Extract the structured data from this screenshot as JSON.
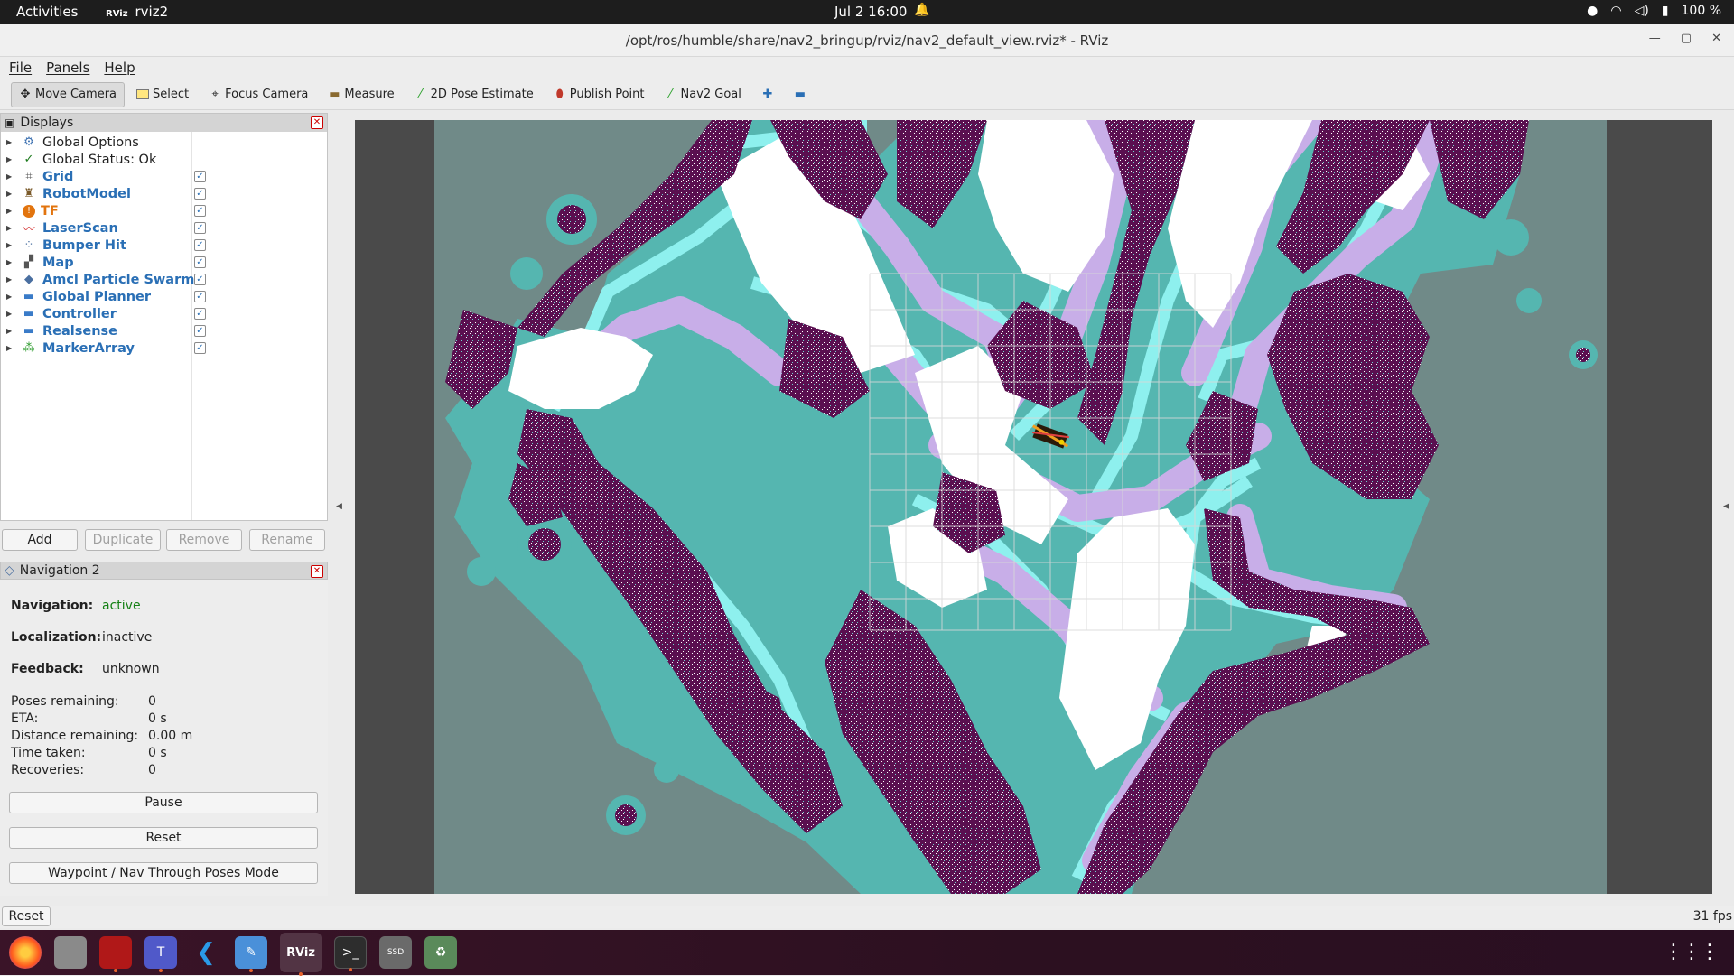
{
  "topbar": {
    "activities": "Activities",
    "app_badge": "RViz",
    "app_name": "rviz2",
    "clock": "Jul 2  16:00",
    "battery": "100 %"
  },
  "window": {
    "title": "/opt/ros/humble/share/nav2_bringup/rviz/nav2_default_view.rviz* - RViz"
  },
  "menu": [
    "File",
    "Panels",
    "Help"
  ],
  "toolbar": [
    {
      "label": "Move Camera",
      "icon": "move-camera-icon",
      "active": true
    },
    {
      "label": "Select",
      "icon": "select-icon"
    },
    {
      "label": "Focus Camera",
      "icon": "focus-camera-icon"
    },
    {
      "label": "Measure",
      "icon": "measure-icon"
    },
    {
      "label": "2D Pose Estimate",
      "icon": "pose-estimate-icon"
    },
    {
      "label": "Publish Point",
      "icon": "publish-point-icon"
    },
    {
      "label": "Nav2 Goal",
      "icon": "nav2-goal-icon"
    }
  ],
  "displays": {
    "title": "Displays",
    "items": [
      {
        "label": "Global Options",
        "style": "plain",
        "icon": "gear-icon",
        "checked": null
      },
      {
        "label": "Global Status: Ok",
        "style": "plain",
        "icon": "checkmark-icon",
        "checked": null
      },
      {
        "label": "Grid",
        "style": "blue",
        "icon": "grid-icon",
        "checked": true
      },
      {
        "label": "RobotModel",
        "style": "blue",
        "icon": "robot-icon",
        "checked": true
      },
      {
        "label": "TF",
        "style": "orange",
        "icon": "warning-icon",
        "checked": true
      },
      {
        "label": "LaserScan",
        "style": "blue",
        "icon": "laser-icon",
        "checked": true
      },
      {
        "label": "Bumper Hit",
        "style": "blue",
        "icon": "points-icon",
        "checked": true
      },
      {
        "label": "Map",
        "style": "blue",
        "icon": "map-icon",
        "checked": true
      },
      {
        "label": "Amcl Particle Swarm",
        "style": "blue",
        "icon": "pose-array-icon",
        "checked": true
      },
      {
        "label": "Global Planner",
        "style": "blue",
        "icon": "folder-icon",
        "checked": true
      },
      {
        "label": "Controller",
        "style": "blue",
        "icon": "folder-icon",
        "checked": true
      },
      {
        "label": "Realsense",
        "style": "blue",
        "icon": "folder-icon",
        "checked": true
      },
      {
        "label": "MarkerArray",
        "style": "blue",
        "icon": "marker-icon",
        "checked": true
      }
    ],
    "buttons": {
      "add": "Add",
      "duplicate": "Duplicate",
      "remove": "Remove",
      "rename": "Rename"
    }
  },
  "nav2": {
    "title": "Navigation 2",
    "navigation_label": "Navigation:",
    "navigation_value": "active",
    "localization_label": "Localization:",
    "localization_value": "inactive",
    "feedback_label": "Feedback:",
    "feedback_value": "unknown",
    "stats": [
      {
        "label": "Poses remaining:",
        "value": "0"
      },
      {
        "label": "ETA:",
        "value": "0 s"
      },
      {
        "label": "Distance remaining:",
        "value": "0.00 m"
      },
      {
        "label": "Time taken:",
        "value": "0 s"
      },
      {
        "label": "Recoveries:",
        "value": "0"
      }
    ],
    "pause": "Pause",
    "reset": "Reset",
    "waypoint_mode": "Waypoint / Nav Through Poses Mode"
  },
  "statusbar": {
    "reset": "Reset",
    "fps": "31 fps"
  },
  "dock": [
    "firefox-icon",
    "files-icon",
    "app-center-icon",
    "teams-icon",
    "vscode-icon",
    "text-editor-icon",
    "rviz-icon",
    "terminal-icon",
    "ssd-icon",
    "trash-icon"
  ],
  "colors": {
    "obstacle": "#5a0f50",
    "inflation_cyan": "#8ef0ee",
    "inflation_teal": "#55b6b0",
    "inflation_lilac": "#c8aee8",
    "free": "#ffffff",
    "unknown": "#708a88"
  }
}
